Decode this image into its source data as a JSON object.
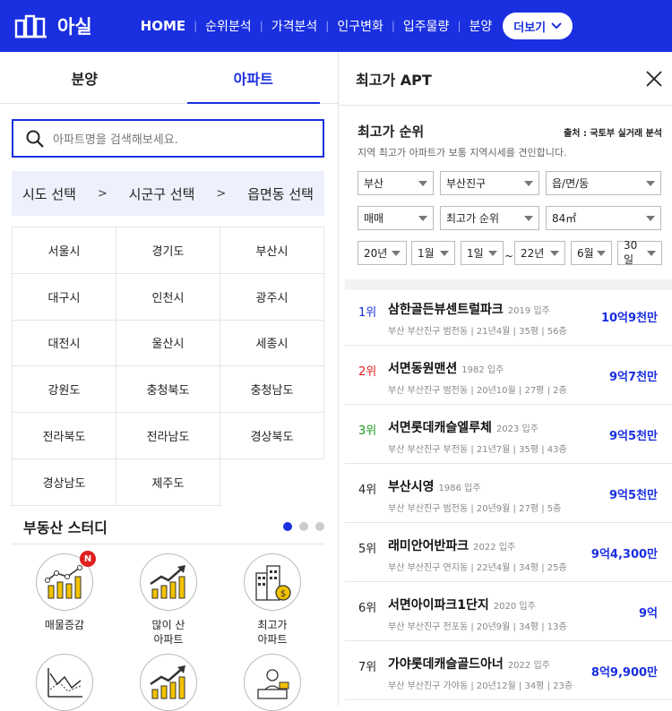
{
  "header": {
    "logo_text": "아실",
    "nav": [
      "HOME",
      "순위분석",
      "가격분석",
      "인구변화",
      "입주물량",
      "분양"
    ],
    "more_label": "더보기"
  },
  "left": {
    "tabs": [
      "분양",
      "아파트"
    ],
    "search_placeholder": "아파트명을 검색해보세요.",
    "region_steps": [
      "시도 선택",
      "시군구 선택",
      "읍면동 선택"
    ],
    "region_arrow": ">",
    "cities": [
      "서울시",
      "경기도",
      "부산시",
      "대구시",
      "인천시",
      "광주시",
      "대전시",
      "울산시",
      "세종시",
      "강원도",
      "충청북도",
      "충청남도",
      "전라북도",
      "전라남도",
      "경상북도",
      "경상남도",
      "제주도"
    ],
    "study_title": "부동산 스터디",
    "study_badge": "N",
    "study_items": [
      "매물증감",
      "많이 산\n아파트",
      "최고가\n아파트"
    ]
  },
  "right": {
    "panel_title": "최고가 APT",
    "rank_title": "최고가 순위",
    "source": "출처 : 국토부 실거래 분석",
    "description": "지역 최고가 아파트가 보통 지역시세를 견인합니다.",
    "filters_row1": [
      "부산",
      "부산진구",
      "읍/면/동"
    ],
    "filters_row2": [
      "매매",
      "최고가 순위",
      "84㎡"
    ],
    "date_from": [
      "20년",
      "1월",
      "1일"
    ],
    "date_sep": "~",
    "date_to": [
      "22년",
      "6월",
      "30일"
    ],
    "apartments": [
      {
        "rank": "1위",
        "name": "삼한골든뷰센트럴파크",
        "year": "2019 입주",
        "meta": "부산 부산진구 범전동 | 21년4월 | 35평 | 56층",
        "price": "10억9천만",
        "rank_color": "#1a2fe0"
      },
      {
        "rank": "2위",
        "name": "서면동원맨션",
        "year": "1982 입주",
        "meta": "부산 부산진구 범전동 | 20년10월 | 27평 | 2층",
        "price": "9억7천만",
        "rank_color": "#e02020"
      },
      {
        "rank": "3위",
        "name": "서면롯데캐슬엘루체",
        "year": "2023 입주",
        "meta": "부산 부산진구 부전동 | 21년7월 | 35평 | 43층",
        "price": "9억5천만",
        "rank_color": "#1a9a1a"
      },
      {
        "rank": "4위",
        "name": "부산시영",
        "year": "1986 입주",
        "meta": "부산 부산진구 범전동 | 20년9월 | 27평 | 5층",
        "price": "9억5천만",
        "rank_color": "#222222"
      },
      {
        "rank": "5위",
        "name": "래미안어반파크",
        "year": "2022 입주",
        "meta": "부산 부산진구 연지동 | 22년4월 | 34평 | 25층",
        "price": "9억4,300만",
        "rank_color": "#222222"
      },
      {
        "rank": "6위",
        "name": "서면아이파크1단지",
        "year": "2020 입주",
        "meta": "부산 부산진구 전포동 | 20년9월 | 34평 | 13층",
        "price": "9억",
        "rank_color": "#222222"
      },
      {
        "rank": "7위",
        "name": "가야롯데캐슬골드아너",
        "year": "2022 입주",
        "meta": "부산 부산진구 가야동 | 20년12월 | 34평 | 23층",
        "price": "8억9,900만",
        "rank_color": "#222222"
      }
    ]
  },
  "colors": {
    "brand": "#1a2fe0",
    "badge": "#e02020"
  }
}
